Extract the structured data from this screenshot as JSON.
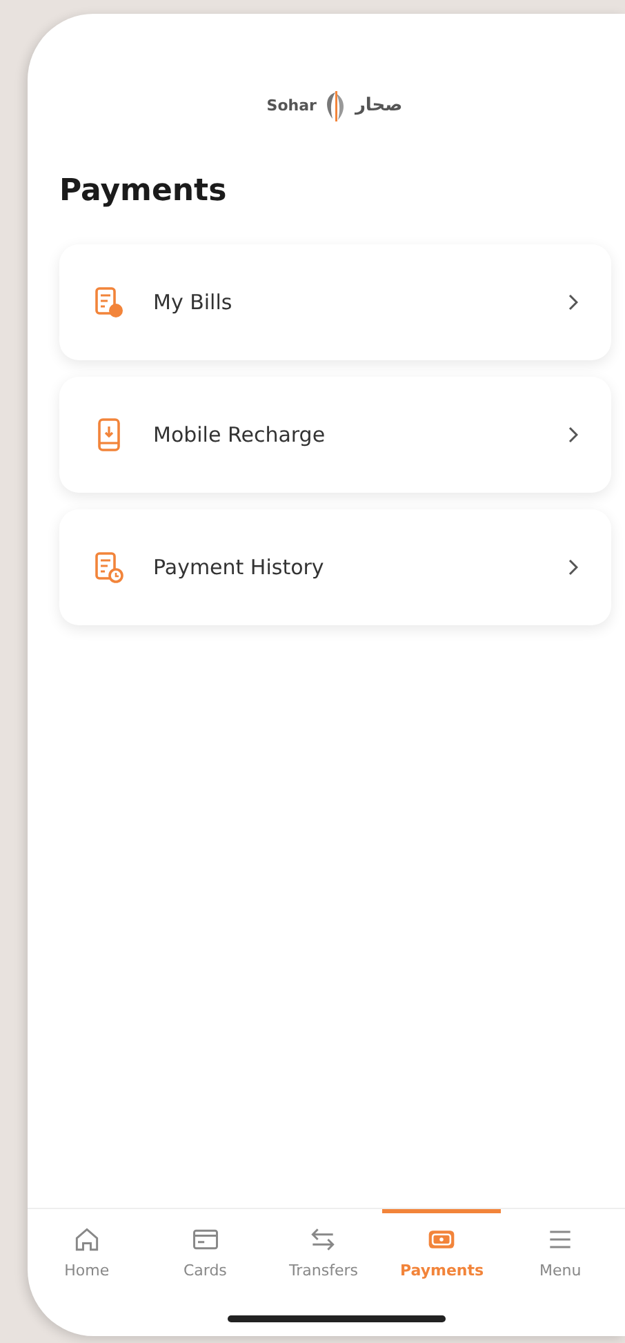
{
  "header": {
    "logo_latin": "Sohar",
    "logo_arabic": "صحار"
  },
  "title": "Payments",
  "menu_items": [
    {
      "label": "My Bills"
    },
    {
      "label": "Mobile Recharge"
    },
    {
      "label": "Payment History"
    }
  ],
  "tab_bar": [
    {
      "label": "Home",
      "selected": false
    },
    {
      "label": "Cards",
      "selected": false
    },
    {
      "label": "Transfers",
      "selected": false
    },
    {
      "label": "Payments",
      "selected": true
    },
    {
      "label": "Menu",
      "selected": false
    }
  ]
}
